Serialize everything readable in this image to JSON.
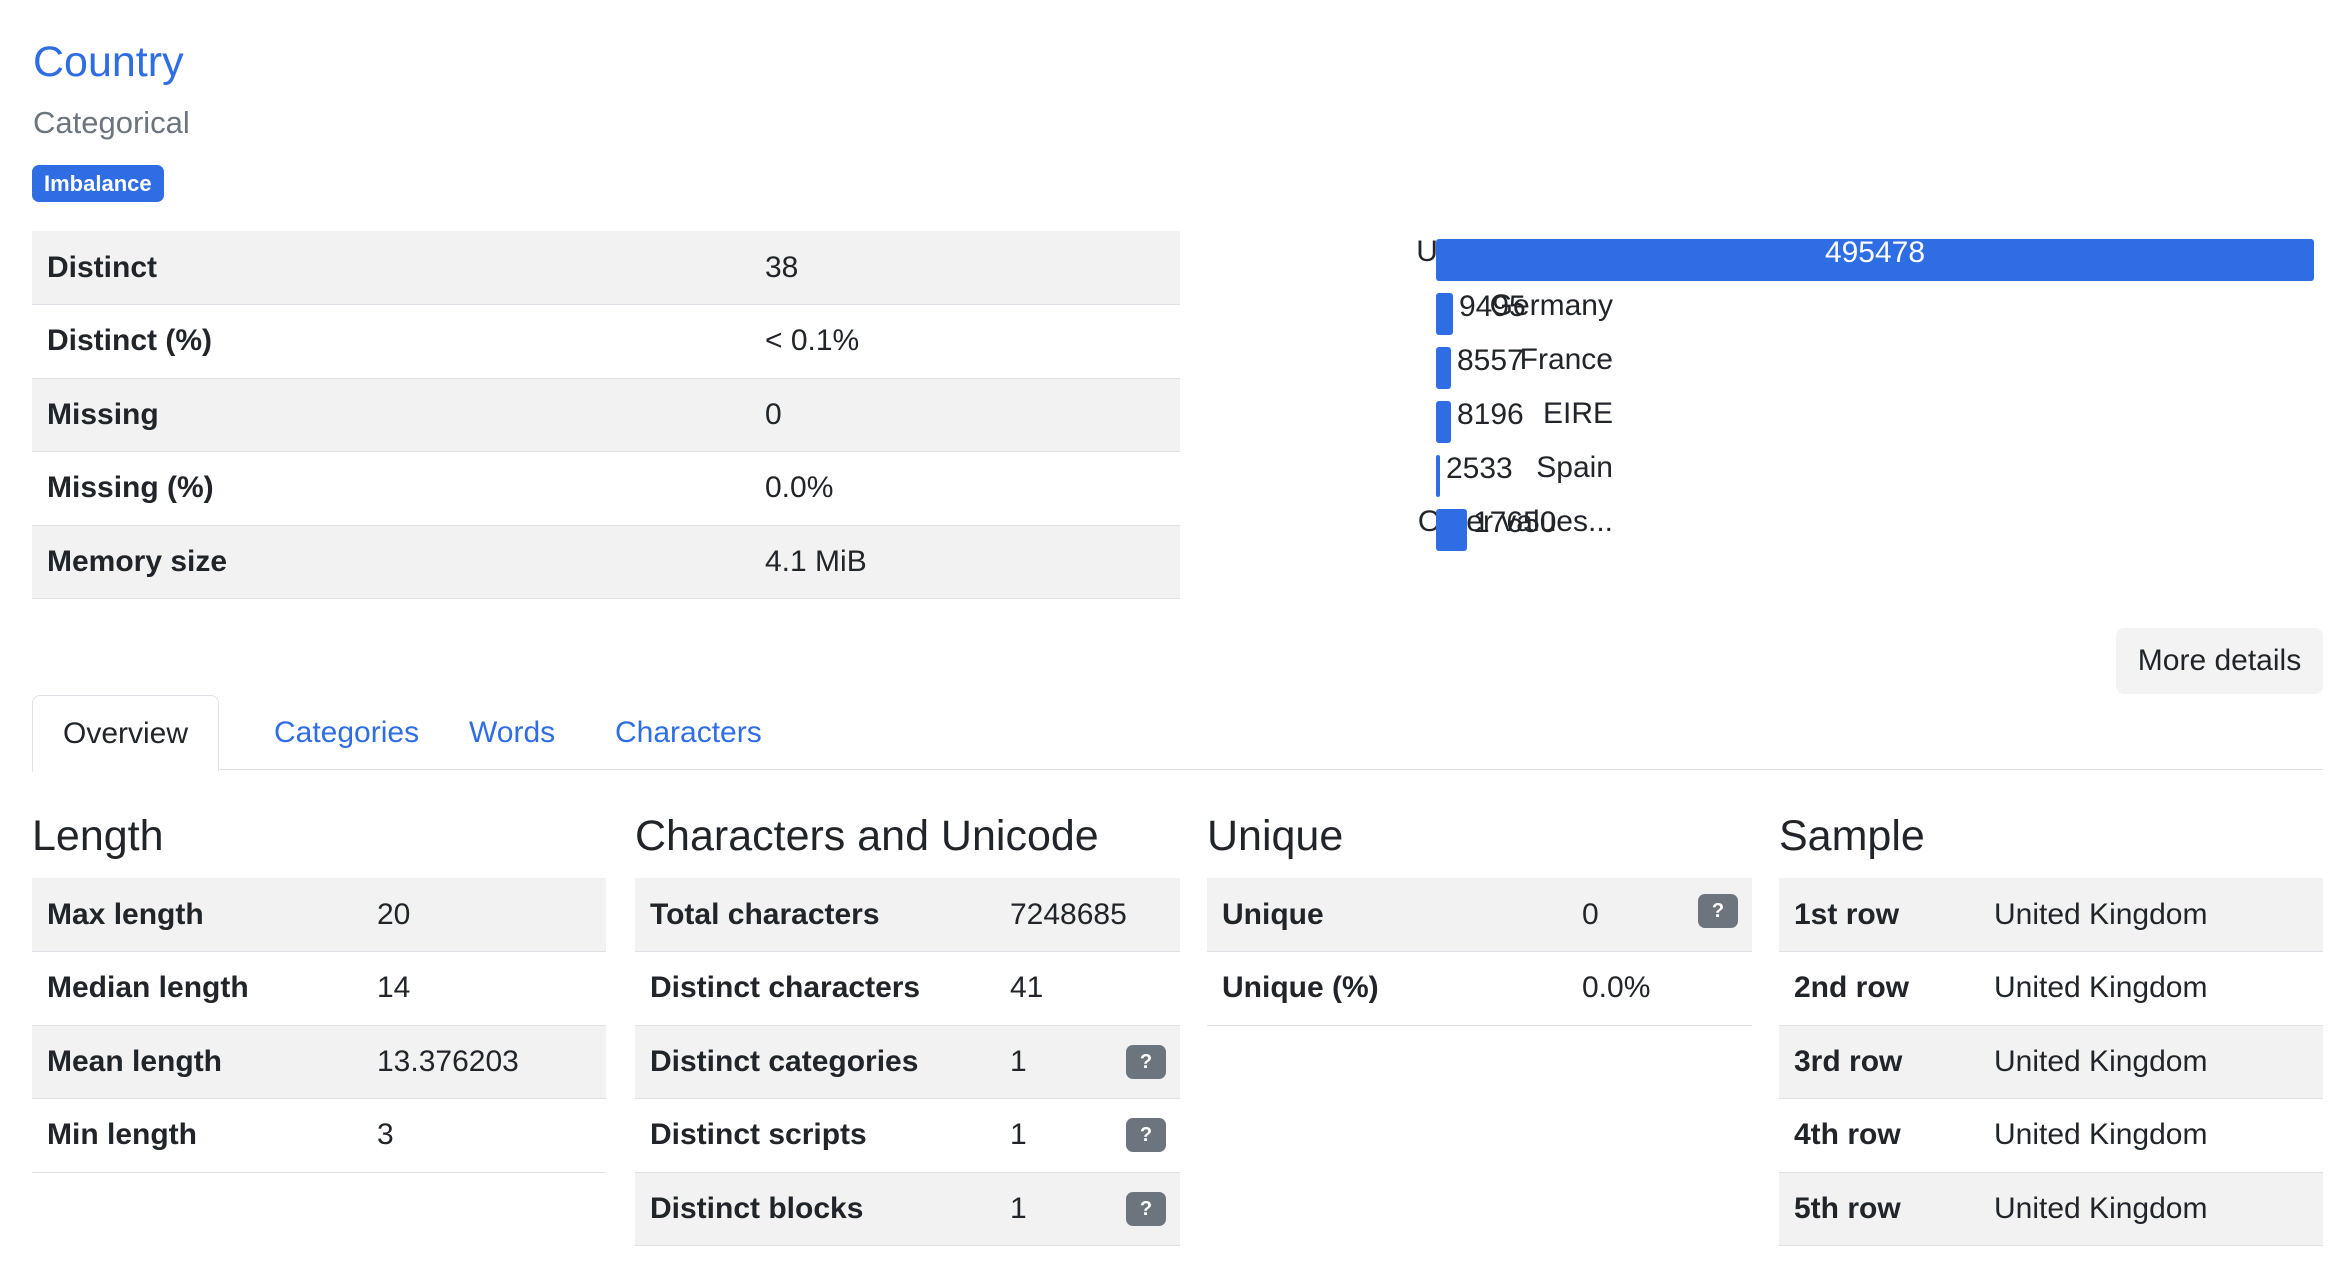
{
  "variable": {
    "title": "Country",
    "type": "Categorical",
    "badge": "Imbalance"
  },
  "stats": [
    {
      "label": "Distinct",
      "value": "38"
    },
    {
      "label": "Distinct (%)",
      "value": "< 0.1%"
    },
    {
      "label": "Missing",
      "value": "0"
    },
    {
      "label": "Missing (%)",
      "value": "0.0%"
    },
    {
      "label": "Memory size",
      "value": "4.1 MiB"
    }
  ],
  "colors": {
    "accent": "#2f6de5",
    "help": "#6c757d",
    "stripe": "#f2f2f2"
  },
  "chart_data": {
    "type": "bar",
    "orientation": "horizontal",
    "categories": [
      "United Kingd...",
      "Germany",
      "France",
      "EIRE",
      "Spain",
      "Other values..."
    ],
    "values": [
      495478,
      9495,
      8557,
      8196,
      2533,
      17650
    ],
    "title": "",
    "xlabel": "",
    "ylabel": ""
  },
  "more_details_label": "More details",
  "tabs": [
    {
      "label": "Overview",
      "active": true
    },
    {
      "label": "Categories",
      "active": false
    },
    {
      "label": "Words",
      "active": false
    },
    {
      "label": "Characters",
      "active": false
    }
  ],
  "length": {
    "title": "Length",
    "rows": [
      {
        "label": "Max length",
        "value": "20"
      },
      {
        "label": "Median length",
        "value": "14"
      },
      {
        "label": "Mean length",
        "value": "13.376203"
      },
      {
        "label": "Min length",
        "value": "3"
      }
    ]
  },
  "characters": {
    "title": "Characters and Unicode",
    "rows": [
      {
        "label": "Total characters",
        "value": "7248685",
        "help": false
      },
      {
        "label": "Distinct characters",
        "value": "41",
        "help": false
      },
      {
        "label": "Distinct categories",
        "value": "1",
        "help": true
      },
      {
        "label": "Distinct scripts",
        "value": "1",
        "help": true
      },
      {
        "label": "Distinct blocks",
        "value": "1",
        "help": true
      }
    ]
  },
  "unique": {
    "title": "Unique",
    "rows": [
      {
        "label": "Unique",
        "value": "0",
        "help": true
      },
      {
        "label": "Unique (%)",
        "value": "0.0%",
        "help": false
      }
    ]
  },
  "sample": {
    "title": "Sample",
    "rows": [
      {
        "label": "1st row",
        "value": "United Kingdom"
      },
      {
        "label": "2nd row",
        "value": "United Kingdom"
      },
      {
        "label": "3rd row",
        "value": "United Kingdom"
      },
      {
        "label": "4th row",
        "value": "United Kingdom"
      },
      {
        "label": "5th row",
        "value": "United Kingdom"
      }
    ]
  },
  "help_glyph": "?"
}
